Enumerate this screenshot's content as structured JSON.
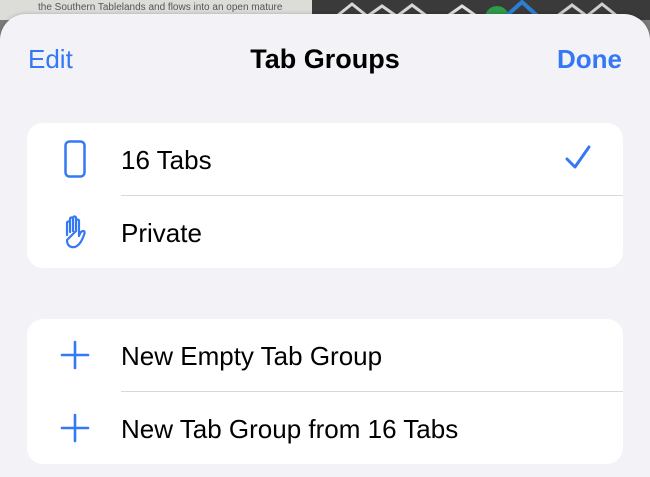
{
  "background": {
    "page_text": "the Southern Tablelands and flows into an open mature"
  },
  "header": {
    "edit_label": "Edit",
    "title": "Tab Groups",
    "done_label": "Done"
  },
  "tab_groups": [
    {
      "label": "16 Tabs",
      "icon": "phone-icon",
      "selected": true
    },
    {
      "label": "Private",
      "icon": "hand-icon",
      "selected": false
    }
  ],
  "actions": [
    {
      "label": "New Empty Tab Group",
      "icon": "plus-icon"
    },
    {
      "label": "New Tab Group from 16 Tabs",
      "icon": "plus-icon"
    }
  ],
  "colors": {
    "accent": "#3478f6",
    "sheet_background": "#f2f2f7",
    "group_background": "#ffffff",
    "divider": "#d8d8dc"
  }
}
